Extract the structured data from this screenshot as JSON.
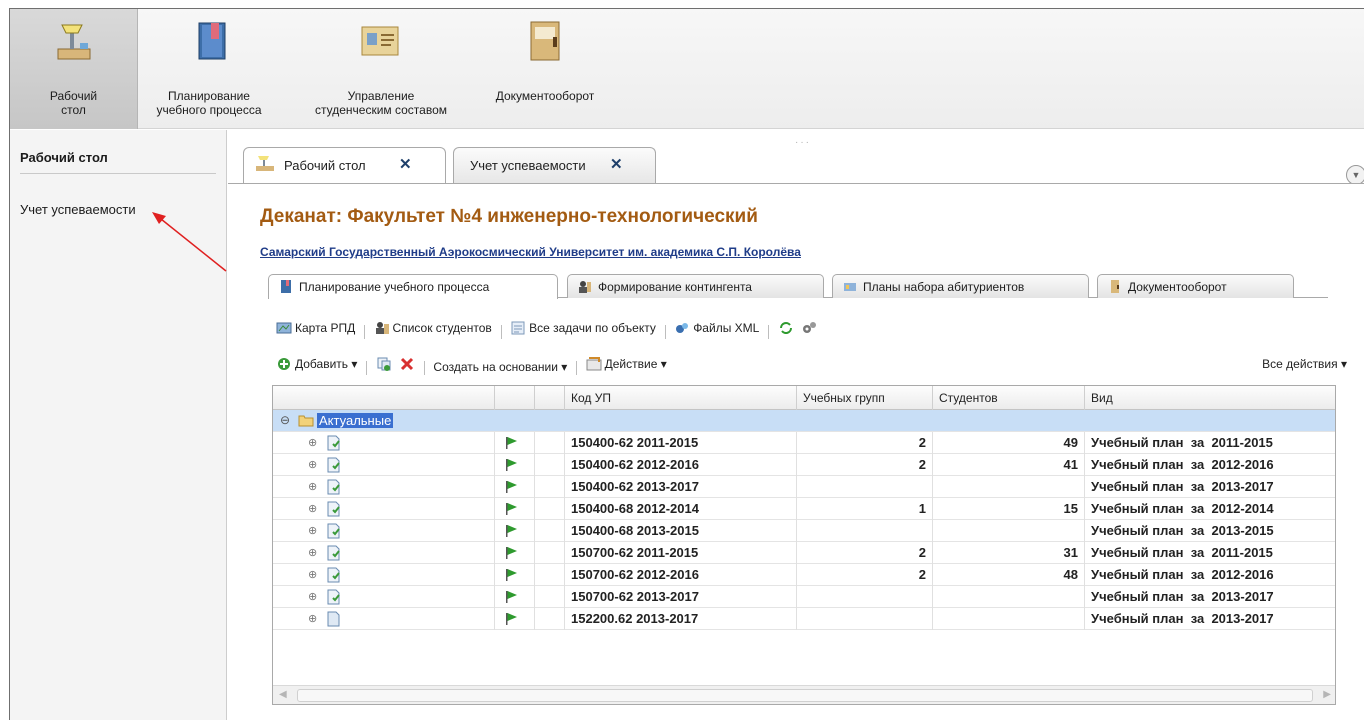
{
  "sections": [
    {
      "line1": "Рабочий",
      "line2": "стол"
    },
    {
      "line1": "Планирование",
      "line2": "учебного процесса"
    },
    {
      "line1": "Управление",
      "line2": "студенческим составом"
    },
    {
      "line1": "Документооборот",
      "line2": ""
    }
  ],
  "panel": {
    "title": "Рабочий стол",
    "link": "Учет успеваемости"
  },
  "window_tabs": [
    {
      "label": "Рабочий стол",
      "close": "✕"
    },
    {
      "label": "Учет успеваемости",
      "close": "✕"
    }
  ],
  "page": {
    "title": "Деканат: Факультет №4 инженерно-технологический",
    "university_link": "Самарский Государственный Аэрокосмический Университет им. академика С.П.  Королёва"
  },
  "subtabs": [
    "Планирование учебного процесса",
    "Формирование контингента",
    "Планы набора абитуриентов",
    "Документооборот"
  ],
  "toolbar1": {
    "map": "Карта РПД",
    "students": "Список студентов",
    "tasks": "Все задачи по объекту",
    "xml": "Файлы XML"
  },
  "toolbar2": {
    "add": "Добавить ▾",
    "create_based": "Создать на основании ▾",
    "action": "Действие ▾",
    "all_actions": "Все действия ▾"
  },
  "grid": {
    "columns": [
      "Код УП",
      "Учебных групп",
      "Студентов",
      "Вид"
    ],
    "group": "Актуальные",
    "rows": [
      {
        "code": "150400-62 2011-2015",
        "groups": "2",
        "students": "49",
        "kind": "Учебный план  за  2011-2015"
      },
      {
        "code": "150400-62 2012-2016",
        "groups": "2",
        "students": "41",
        "kind": "Учебный план  за  2012-2016"
      },
      {
        "code": "150400-62 2013-2017",
        "groups": "",
        "students": "",
        "kind": "Учебный план  за  2013-2017"
      },
      {
        "code": "150400-68 2012-2014",
        "groups": "1",
        "students": "15",
        "kind": "Учебный план  за  2012-2014"
      },
      {
        "code": "150400-68 2013-2015",
        "groups": "",
        "students": "",
        "kind": "Учебный план  за  2013-2015"
      },
      {
        "code": "150700-62 2011-2015",
        "groups": "2",
        "students": "31",
        "kind": "Учебный план  за  2011-2015"
      },
      {
        "code": "150700-62 2012-2016",
        "groups": "2",
        "students": "48",
        "kind": "Учебный план  за  2012-2016"
      },
      {
        "code": "150700-62 2013-2017",
        "groups": "",
        "students": "",
        "kind": "Учебный план  за  2013-2017"
      },
      {
        "code": "152200.62 2013-2017",
        "groups": "",
        "students": "",
        "kind": "Учебный план  за  2013-2017"
      }
    ]
  },
  "colors": {
    "title": "#a35b12",
    "link": "#1f3c88",
    "selection": "#c8def6",
    "flag": "#2e9a2e",
    "arrow": "#e02020"
  }
}
